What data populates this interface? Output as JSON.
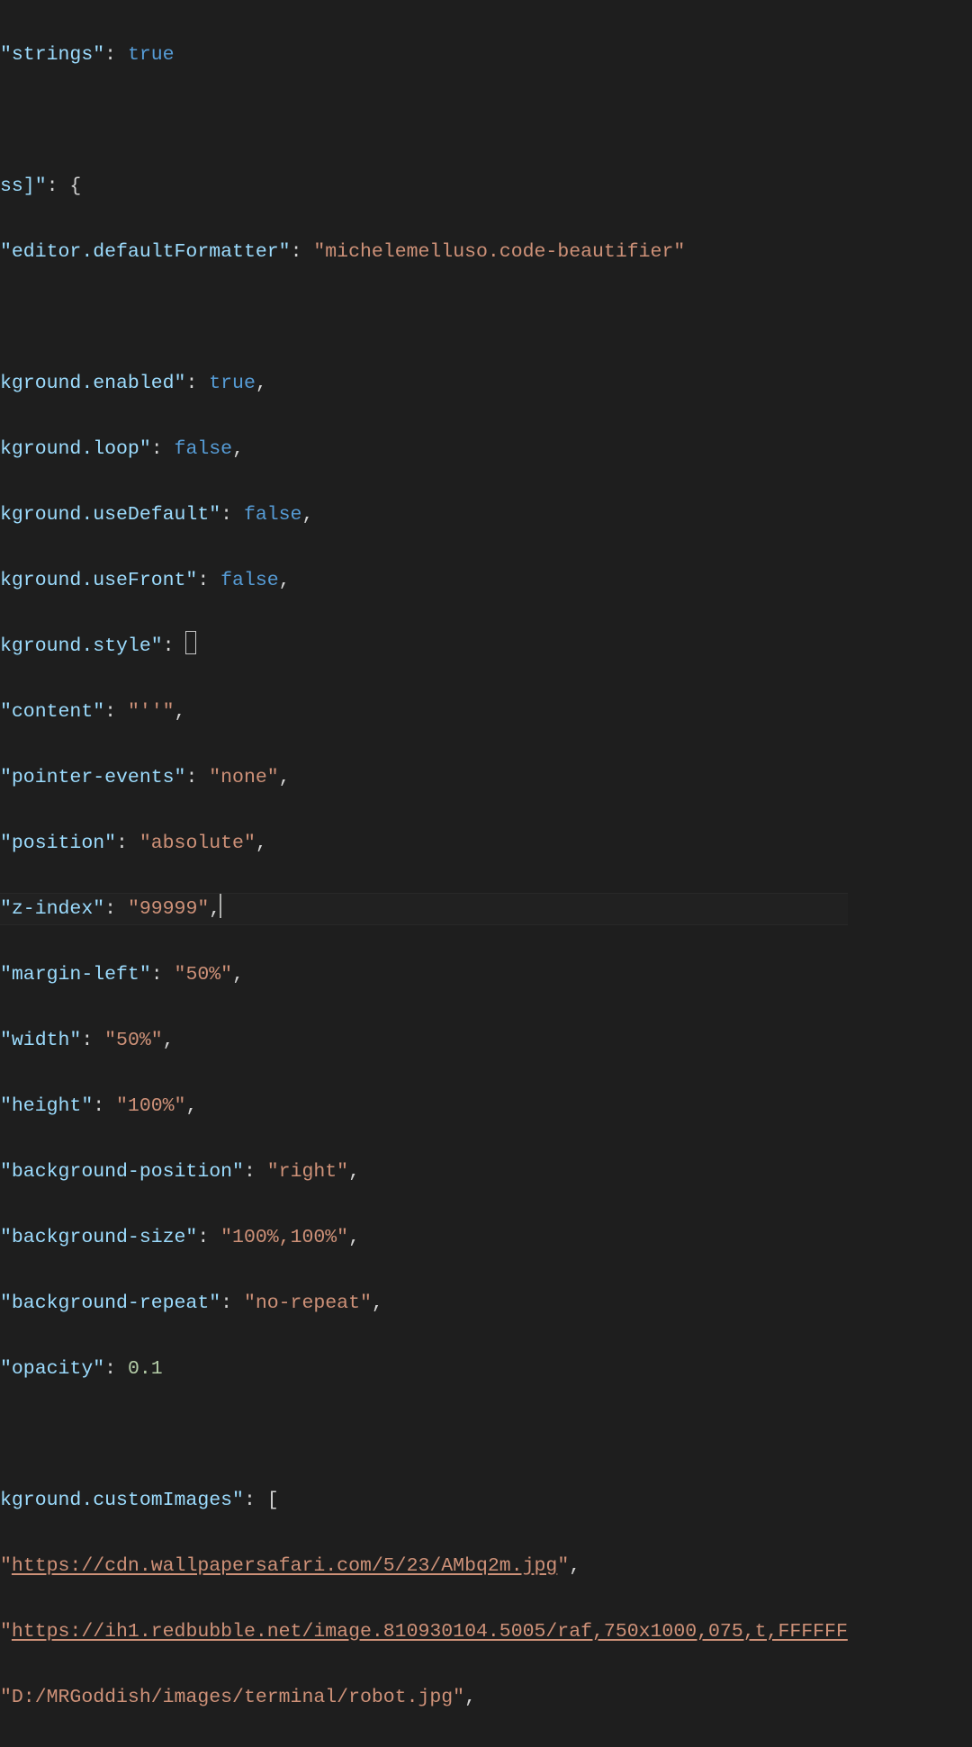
{
  "lines": {
    "l1_key": "\"strings\"",
    "l1_val": "true",
    "l3_key_partial": "ss]\"",
    "l4_key": "\"editor.defaultFormatter\"",
    "l4_val": "\"michelemelluso.code-beautifier\"",
    "l6_key": "kground.enabled\"",
    "l6_val": "true",
    "l7_key": "kground.loop\"",
    "l7_val": "false",
    "l8_key": "kground.useDefault\"",
    "l8_val": "false",
    "l9_key": "kground.useFront\"",
    "l9_val": "false",
    "l10_key": "kground.style\"",
    "l11_key": "\"content\"",
    "l11_val": "\"''\"",
    "l12_key": "\"pointer-events\"",
    "l12_val": "\"none\"",
    "l13_key": "\"position\"",
    "l13_val": "\"absolute\"",
    "l14_key": "\"z-index\"",
    "l14_val": "\"99999\"",
    "l15_key": "\"margin-left\"",
    "l15_val": "\"50%\"",
    "l16_key": "\"width\"",
    "l16_val": "\"50%\"",
    "l17_key": "\"height\"",
    "l17_val": "\"100%\"",
    "l18_key": "\"background-position\"",
    "l18_val": "\"right\"",
    "l19_key": "\"background-size\"",
    "l19_val": "\"100%,100%\"",
    "l20_key": "\"background-repeat\"",
    "l20_val": "\"no-repeat\"",
    "l21_key": "\"opacity\"",
    "l21_val": "0.1",
    "l23_key": "kground.customImages\"",
    "l24_val": "https://cdn.wallpapersafari.com/5/23/АМbq2m.jpg",
    "l25_val": "https://ih1.redbubble.net/image.810930104.5005/raf,750x1000,075,t,FFFFFF",
    "l26_val": "\"D:/MRGoddish/images/terminal/robot.jpg\""
  },
  "colors": {
    "bg": "#1e1e1e",
    "key": "#9cdcfe",
    "string": "#ce9178",
    "number": "#b5cea8",
    "boolean": "#569cd6",
    "punct": "#d4d4d4"
  }
}
